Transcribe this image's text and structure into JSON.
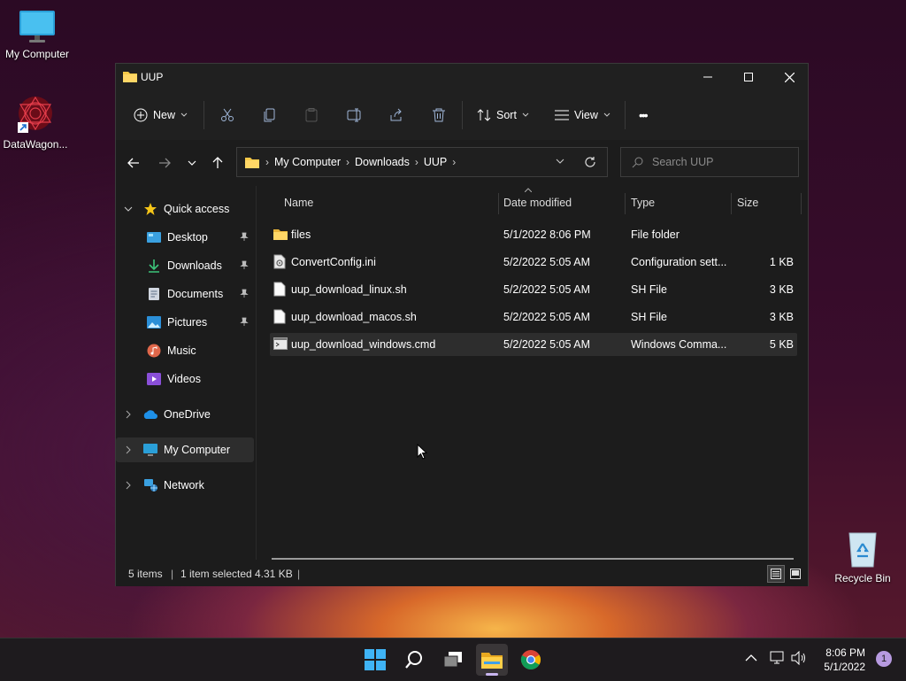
{
  "desktop": {
    "icons": [
      {
        "label": "My Computer"
      },
      {
        "label": "DataWagon..."
      },
      {
        "label": "Recycle Bin"
      }
    ]
  },
  "window": {
    "title": "UUP",
    "toolbar": {
      "new_label": "New",
      "sort_label": "Sort",
      "view_label": "View",
      "more_label": "•••"
    },
    "address": {
      "crumbs": [
        "My Computer",
        "Downloads",
        "UUP"
      ]
    },
    "search": {
      "placeholder": "Search UUP"
    },
    "sidebar": {
      "quick_access": "Quick access",
      "items": [
        {
          "label": "Desktop",
          "pinned": true
        },
        {
          "label": "Downloads",
          "pinned": true
        },
        {
          "label": "Documents",
          "pinned": true
        },
        {
          "label": "Pictures",
          "pinned": true
        },
        {
          "label": "Music",
          "pinned": false
        },
        {
          "label": "Videos",
          "pinned": false
        }
      ],
      "onedrive": "OneDrive",
      "my_computer": "My Computer",
      "network": "Network"
    },
    "columns": {
      "name": "Name",
      "date": "Date modified",
      "type": "Type",
      "size": "Size"
    },
    "files": [
      {
        "name": "files",
        "date": "5/1/2022 8:06 PM",
        "type": "File folder",
        "size": "",
        "icon": "folder-icon"
      },
      {
        "name": "ConvertConfig.ini",
        "date": "5/2/2022 5:05 AM",
        "type": "Configuration sett...",
        "size": "1 KB",
        "icon": "settings-file-icon"
      },
      {
        "name": "uup_download_linux.sh",
        "date": "5/2/2022 5:05 AM",
        "type": "SH File",
        "size": "3 KB",
        "icon": "file-icon"
      },
      {
        "name": "uup_download_macos.sh",
        "date": "5/2/2022 5:05 AM",
        "type": "SH File",
        "size": "3 KB",
        "icon": "file-icon"
      },
      {
        "name": "uup_download_windows.cmd",
        "date": "5/2/2022 5:05 AM",
        "type": "Windows Comma...",
        "size": "5 KB",
        "icon": "cmd-file-icon"
      }
    ],
    "selected_row": 4,
    "status": {
      "items": "5 items",
      "selection": "1 item selected",
      "selection_size": "4.31 KB",
      "bar": "|"
    }
  },
  "taskbar": {
    "time": "8:06 PM",
    "date": "5/1/2022",
    "notifications": "1"
  }
}
